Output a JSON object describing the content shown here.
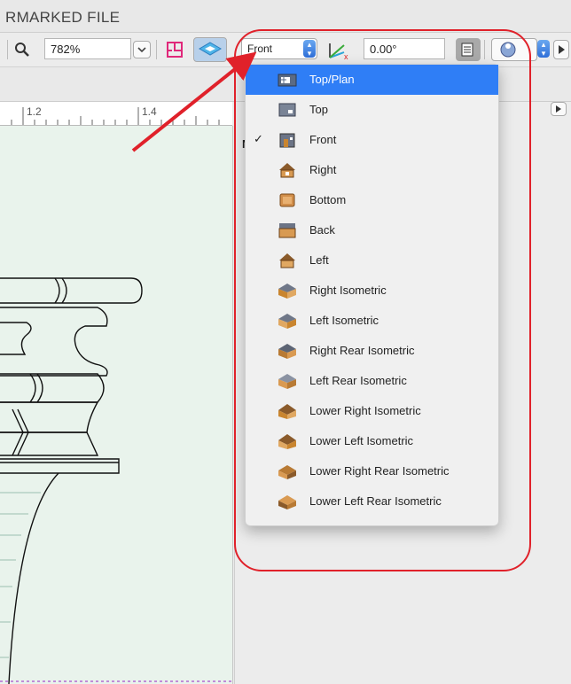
{
  "window": {
    "title": "RMARKED FILE"
  },
  "toolbar": {
    "zoom": "782%",
    "view_select": "Front",
    "angle": "0.00°"
  },
  "ruler": {
    "ticks": [
      "1.2",
      "1.4"
    ]
  },
  "right_panel": {
    "header_fragment": "N"
  },
  "menu": {
    "items": [
      {
        "label": "Top/Plan",
        "icon": "top-plan-icon",
        "highlighted": true,
        "checked": false
      },
      {
        "label": "Top",
        "icon": "top-icon",
        "highlighted": false,
        "checked": false
      },
      {
        "label": "Front",
        "icon": "front-icon",
        "highlighted": false,
        "checked": true
      },
      {
        "label": "Right",
        "icon": "right-icon",
        "highlighted": false,
        "checked": false
      },
      {
        "label": "Bottom",
        "icon": "bottom-icon",
        "highlighted": false,
        "checked": false
      },
      {
        "label": "Back",
        "icon": "back-icon",
        "highlighted": false,
        "checked": false
      },
      {
        "label": "Left",
        "icon": "left-icon",
        "highlighted": false,
        "checked": false
      },
      {
        "label": "Right Isometric",
        "icon": "right-isometric-icon",
        "highlighted": false,
        "checked": false
      },
      {
        "label": "Left Isometric",
        "icon": "left-isometric-icon",
        "highlighted": false,
        "checked": false
      },
      {
        "label": "Right Rear Isometric",
        "icon": "right-rear-isometric-icon",
        "highlighted": false,
        "checked": false
      },
      {
        "label": "Left Rear Isometric",
        "icon": "left-rear-isometric-icon",
        "highlighted": false,
        "checked": false
      },
      {
        "label": "Lower Right Isometric",
        "icon": "lower-right-isometric-icon",
        "highlighted": false,
        "checked": false
      },
      {
        "label": "Lower Left Isometric",
        "icon": "lower-left-isometric-icon",
        "highlighted": false,
        "checked": false
      },
      {
        "label": "Lower Right Rear Isometric",
        "icon": "lower-right-rear-isometric-icon",
        "highlighted": false,
        "checked": false
      },
      {
        "label": "Lower Left Rear Isometric",
        "icon": "lower-left-rear-isometric-icon",
        "highlighted": false,
        "checked": false
      }
    ],
    "check_glyph": "✓"
  },
  "colors": {
    "highlight": "#2f7ef6",
    "annotation": "#e0212a",
    "canvas": "#e9f3ec"
  }
}
